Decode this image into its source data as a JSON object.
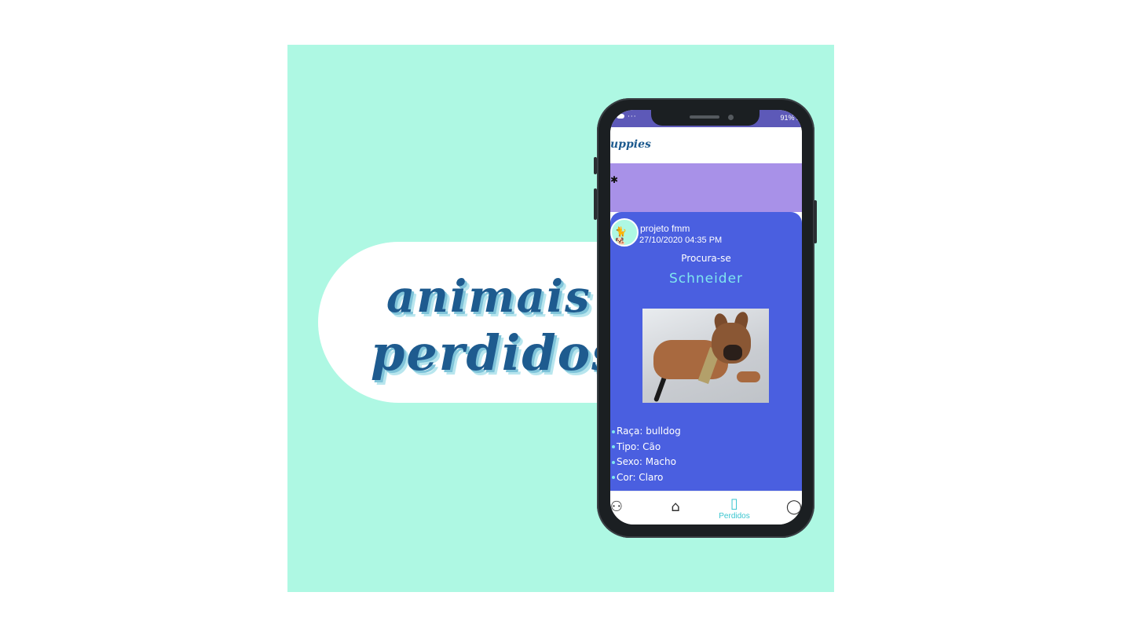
{
  "banner": {
    "headline_line1": "animais",
    "headline_line2": "perdidos"
  },
  "colors": {
    "mint": "#aef8e3",
    "card_blue": "#4a5fe0",
    "purple_band": "#a891e8",
    "accent_teal": "#39c5cf",
    "brand_navy": "#1e5b8f"
  },
  "statusbar": {
    "left_dots": "···",
    "right": "91% 2"
  },
  "appbar": {
    "logo": "uppies"
  },
  "post": {
    "user_name": "projeto fmm",
    "timestamp": "27/10/2020 04:35 PM",
    "status": "Procura-se",
    "pet_name": "Schneider",
    "details": [
      "Raça: bulldog",
      "Tipo: Cão",
      "Sexo: Macho",
      "Cor: Claro"
    ]
  },
  "bottom_nav": {
    "items": [
      {
        "icon": "person-icon",
        "label": ""
      },
      {
        "icon": "adopt-house-icon",
        "label": ""
      },
      {
        "icon": "lost-poster-icon",
        "label": "Perdidos",
        "active": true
      },
      {
        "icon": "chat-icon",
        "label": ""
      }
    ]
  }
}
